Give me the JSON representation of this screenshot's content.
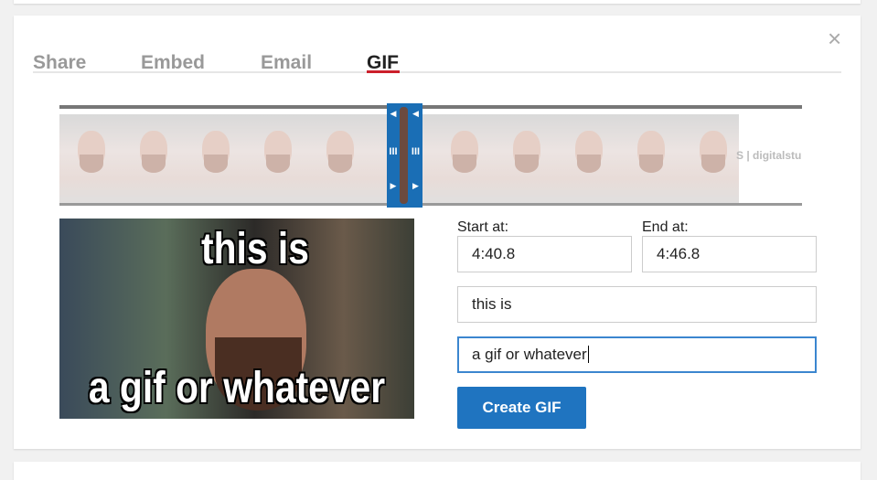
{
  "tabs": [
    {
      "label": "Share"
    },
    {
      "label": "Embed"
    },
    {
      "label": "Email"
    },
    {
      "label": "GIF",
      "active": true
    }
  ],
  "close_icon": "×",
  "filmstrip": {
    "end_text": "S | digitalstu"
  },
  "preview": {
    "top_text": "this is",
    "bottom_text": "a gif or whatever"
  },
  "form": {
    "start_label": "Start at:",
    "start_value": "4:40.8",
    "end_label": "End at:",
    "end_value": "4:46.8",
    "top_text_value": "this is",
    "bottom_text_value": "a gif or whatever",
    "create_label": "Create GIF"
  },
  "colors": {
    "accent": "#1f74c0",
    "tab_underline": "#cc1f2b"
  }
}
